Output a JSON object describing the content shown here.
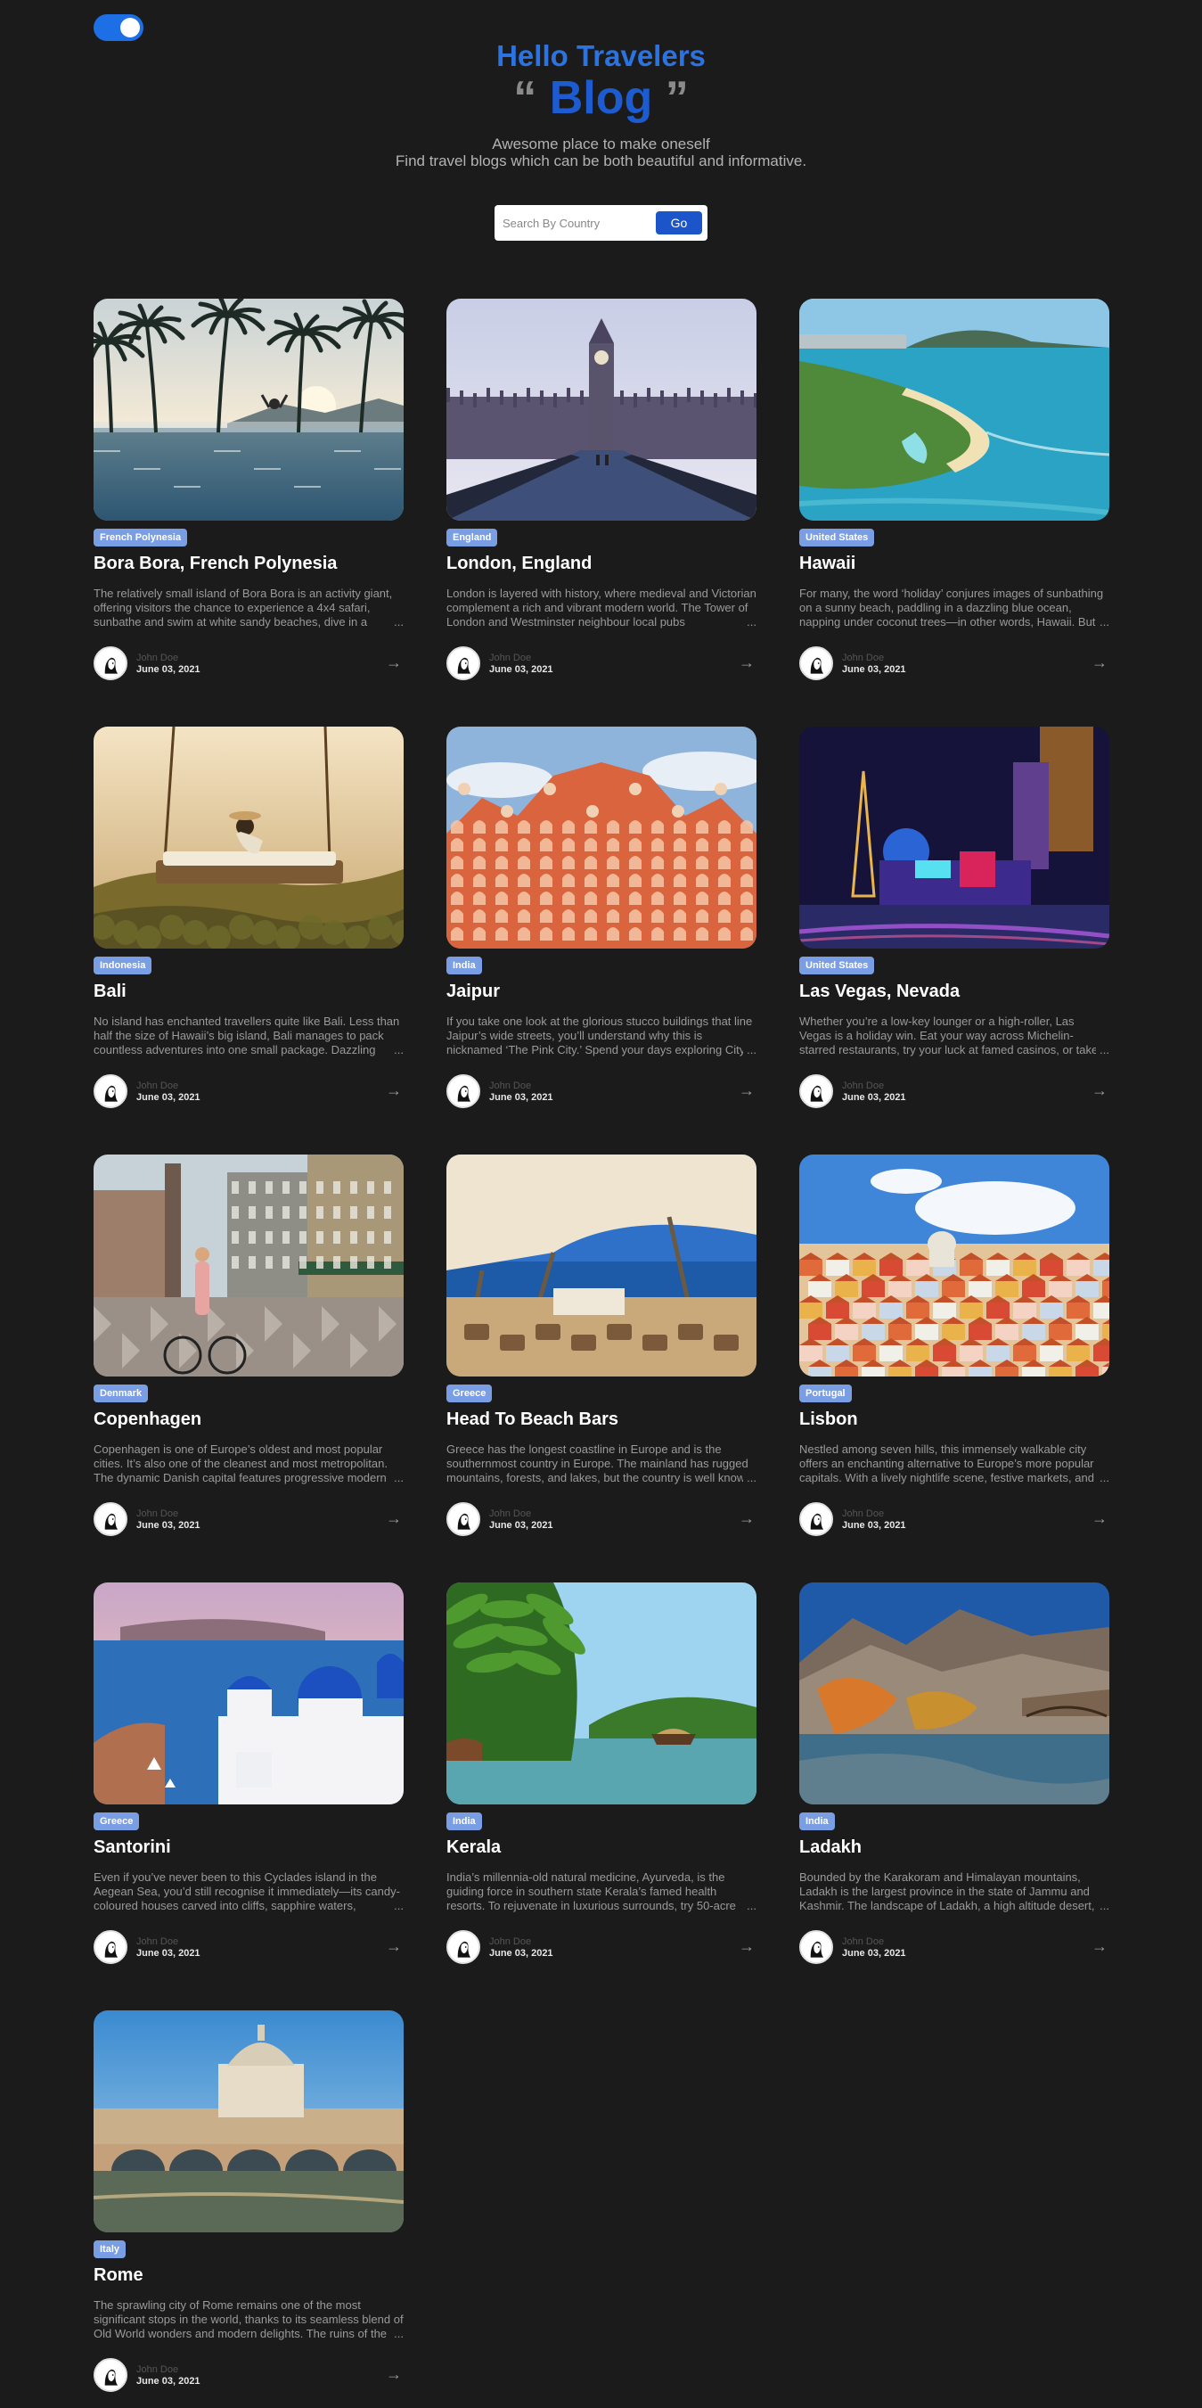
{
  "header": {
    "hello": "Hello Travelers",
    "quote_open": "“",
    "blog": "Blog",
    "quote_close": "”",
    "subtitle_1": "Awesome place to make oneself",
    "subtitle_2": "Find travel blogs which can be both beautiful and informative."
  },
  "theme_toggle": {
    "state": "on"
  },
  "search": {
    "placeholder": "Search By Country",
    "value": "",
    "button": "Go"
  },
  "colors": {
    "background": "#1c1b1b",
    "accent": "#1d6fe6",
    "tag": "#7a9ee3"
  },
  "posts": [
    {
      "country": "French Polynesia",
      "title": "Bora Bora, French Polynesia",
      "description": "The relatively small island of Bora Bora is an activity giant, offering visitors the chance to experience a 4x4 safari, sunbathe and swim at white sandy beaches, dive in a",
      "author": "John Doe",
      "date": "June 03, 2021",
      "image": "bora-bora"
    },
    {
      "country": "England",
      "title": "London, England",
      "description": "London is layered with history, where medieval and Victorian complement a rich and vibrant modern world. The Tower of London and Westminster neighbour local pubs",
      "author": "John Doe",
      "date": "June 03, 2021",
      "image": "london"
    },
    {
      "country": "United States",
      "title": "Hawaii",
      "description": "For many, the word ‘holiday’ conjures images of sunbathing on a sunny beach, paddling in a dazzling blue ocean, napping under coconut trees—in other words, Hawaii. But",
      "author": "John Doe",
      "date": "June 03, 2021",
      "image": "hawaii"
    },
    {
      "country": "Indonesia",
      "title": "Bali",
      "description": "No island has enchanted travellers quite like Bali. Less than half the size of Hawaii’s big island, Bali manages to pack countless adventures into one small package. Dazzling",
      "author": "John Doe",
      "date": "June 03, 2021",
      "image": "bali"
    },
    {
      "country": "India",
      "title": "Jaipur",
      "description": "If you take one look at the glorious stucco buildings that line Jaipur’s wide streets, you’ll understand why this is nicknamed ‘The Pink City.’ Spend your days exploring City",
      "author": "John Doe",
      "date": "June 03, 2021",
      "image": "jaipur"
    },
    {
      "country": "United States",
      "title": "Las Vegas, Nevada",
      "description": "Whether you’re a low-key lounger or a high-roller, Las Vegas is a holiday win. Eat your way across Michelin-starred restaurants, try your luck at famed casinos, or take",
      "author": "John Doe",
      "date": "June 03, 2021",
      "image": "las-vegas"
    },
    {
      "country": "Denmark",
      "title": "Copenhagen",
      "description": "Copenhagen is one of Europe’s oldest and most popular cities. It’s also one of the cleanest and most metropolitan. The dynamic Danish capital features progressive modern",
      "author": "John Doe",
      "date": "June 03, 2021",
      "image": "copenhagen"
    },
    {
      "country": "Greece",
      "title": "Head To Beach Bars",
      "description": "Greece has the longest coastline in Europe and is the southernmost country in Europe. The mainland has rugged mountains, forests, and lakes, but the country is well known",
      "author": "John Doe",
      "date": "June 03, 2021",
      "image": "beach-bars"
    },
    {
      "country": "Portugal",
      "title": "Lisbon",
      "description": "Nestled among seven hills, this immensely walkable city offers an enchanting alternative to Europe’s more popular capitals. With a lively nightlife scene, festive markets, and",
      "author": "John Doe",
      "date": "June 03, 2021",
      "image": "lisbon"
    },
    {
      "country": "Greece",
      "title": "Santorini",
      "description": "Even if you’ve never been to this Cyclades island in the Aegean Sea, you’d still recognise it immediately—its candy-coloured houses carved into cliffs, sapphire waters,",
      "author": "John Doe",
      "date": "June 03, 2021",
      "image": "santorini"
    },
    {
      "country": "India",
      "title": "Kerala",
      "description": "India’s millennia-old natural medicine, Ayurveda, is the guiding force in southern state Kerala’s famed health resorts. To rejuvenate in luxurious surrounds, try 50-acre",
      "author": "John Doe",
      "date": "June 03, 2021",
      "image": "kerala"
    },
    {
      "country": "India",
      "title": "Ladakh",
      "description": "Bounded by the Karakoram and Himalayan mountains, Ladakh is the largest province in the state of Jammu and Kashmir. The landscape of Ladakh, a high altitude desert,",
      "author": "John Doe",
      "date": "June 03, 2021",
      "image": "ladakh"
    },
    {
      "country": "Italy",
      "title": "Rome",
      "description": "The sprawling city of Rome remains one of the most significant stops in the world, thanks to its seamless blend of Old World wonders and modern delights. The ruins of the",
      "author": "John Doe",
      "date": "June 03, 2021",
      "image": "rome"
    }
  ]
}
